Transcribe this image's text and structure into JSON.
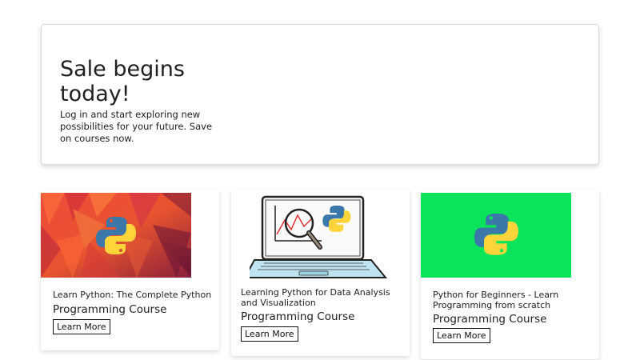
{
  "hero": {
    "title": "Sale begins today!",
    "text": "Log in and start exploring new possibilities for your future. Save on courses now."
  },
  "courses": [
    {
      "title": "Learn Python: The Complete Python",
      "subtitle": "Programming Course",
      "button": "Learn More",
      "image": "python-logo-on-red-geometric-pattern"
    },
    {
      "title": "Learning Python for Data Analysis and Visualization",
      "subtitle": "Programming Course",
      "button": "Learn More",
      "image": "laptop-with-chart-magnifier-and-python-logo"
    },
    {
      "title": "Python for Beginners - Learn Programming from scratch",
      "subtitle": "Programming Course",
      "button": "Learn More",
      "image": "python-logo-on-green"
    }
  ],
  "colors": {
    "green_bg": "#0ae45a",
    "python_blue": "#3b77a8",
    "python_yellow": "#ffd43b"
  }
}
